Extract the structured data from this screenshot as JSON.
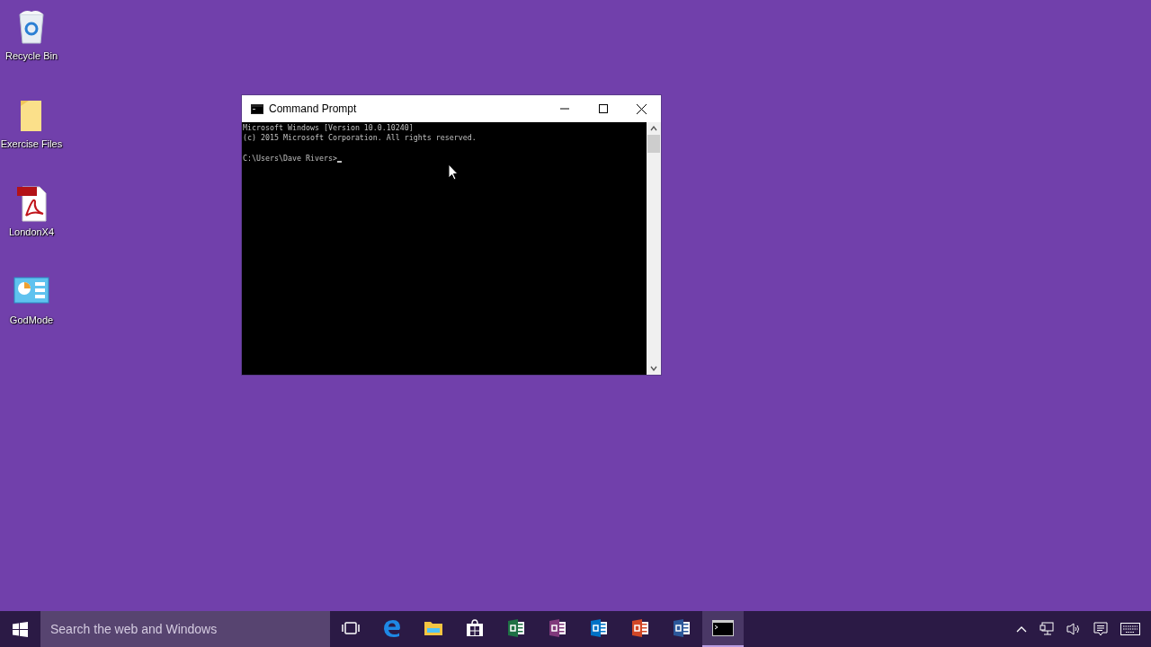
{
  "desktop_icons": [
    {
      "kind": "recycle",
      "label": "Recycle Bin"
    },
    {
      "kind": "folder",
      "label": "Exercise Files"
    },
    {
      "kind": "pdf",
      "label": "LondonX4"
    },
    {
      "kind": "panel",
      "label": "GodMode"
    }
  ],
  "window": {
    "title": "Command Prompt",
    "lines": [
      "Microsoft Windows [Version 10.0.10240]",
      "(c) 2015 Microsoft Corporation. All rights reserved."
    ],
    "prompt": "C:\\Users\\Dave Rivers>"
  },
  "taskbar": {
    "search": {
      "placeholder": "Search the web and Windows"
    },
    "apps": [
      {
        "kind": "taskview",
        "selected": false
      },
      {
        "kind": "edge",
        "selected": false
      },
      {
        "kind": "explorer",
        "selected": false
      },
      {
        "kind": "store",
        "selected": false
      },
      {
        "kind": "excel",
        "selected": false
      },
      {
        "kind": "onenote",
        "selected": false
      },
      {
        "kind": "outlook",
        "selected": false
      },
      {
        "kind": "powerpoint",
        "selected": false
      },
      {
        "kind": "word",
        "selected": false
      },
      {
        "kind": "console",
        "selected": true
      }
    ]
  }
}
